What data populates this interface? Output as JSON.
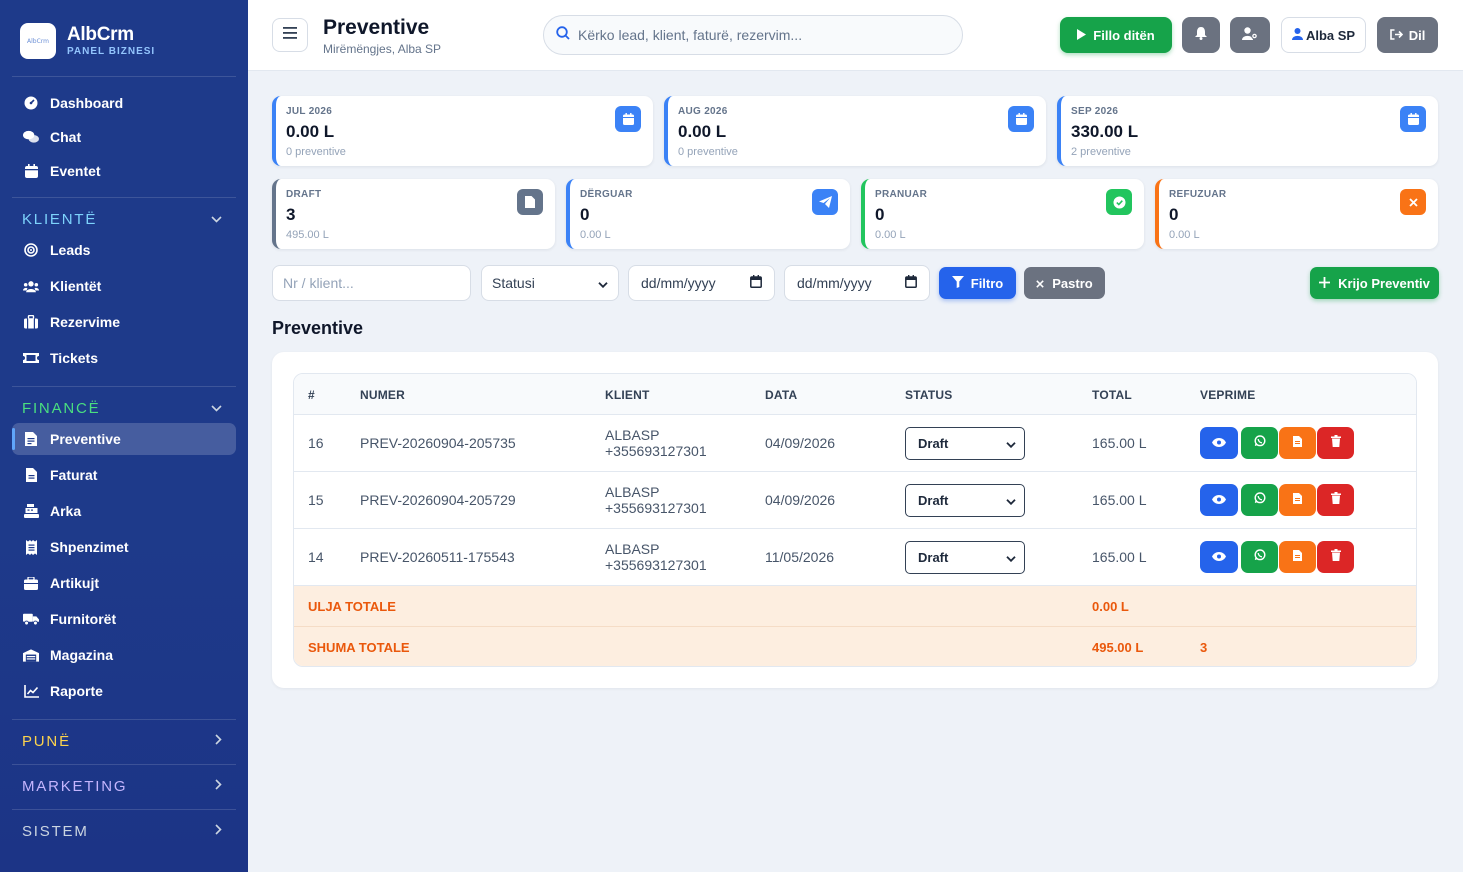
{
  "brand": {
    "name": "AlbCrm",
    "subtitle": "PANEL BIZNESI",
    "logo_text": "AlbCrm"
  },
  "sidebar": {
    "main": [
      {
        "label": "Dashboard",
        "icon": "gauge-icon"
      },
      {
        "label": "Chat",
        "icon": "chat-icon"
      },
      {
        "label": "Eventet",
        "icon": "calendar-icon"
      }
    ],
    "klientet": {
      "title": "KLIENTË",
      "color": "#7dd3fc",
      "items": [
        {
          "label": "Leads",
          "icon": "bullseye-icon"
        },
        {
          "label": "Klientët",
          "icon": "users-icon"
        },
        {
          "label": "Rezervime",
          "icon": "suitcase-icon"
        },
        {
          "label": "Tickets",
          "icon": "ticket-icon"
        }
      ]
    },
    "financa": {
      "title": "FINANCË",
      "color": "#4ade80",
      "items": [
        {
          "label": "Preventive",
          "icon": "file-invoice-icon",
          "active": true
        },
        {
          "label": "Faturat",
          "icon": "file-icon"
        },
        {
          "label": "Arka",
          "icon": "cash-register-icon"
        },
        {
          "label": "Shpenzimet",
          "icon": "receipt-icon"
        },
        {
          "label": "Artikujt",
          "icon": "box-icon"
        },
        {
          "label": "Furnitorët",
          "icon": "truck-icon"
        },
        {
          "label": "Magazina",
          "icon": "warehouse-icon"
        },
        {
          "label": "Raporte",
          "icon": "chart-line-icon"
        }
      ]
    },
    "collapsed": [
      {
        "title": "PUNË",
        "color": "#fcd34d"
      },
      {
        "title": "MARKETING",
        "color": "#c4b5fd"
      },
      {
        "title": "SISTEM",
        "color": "#cbd5e1"
      }
    ]
  },
  "header": {
    "title": "Preventive",
    "subtitle": "Mirëmëngjes, Alba SP",
    "search_placeholder": "Kërko lead, klient, faturë, rezervim...",
    "start_day_label": "Fillo ditën",
    "user_label": "Alba SP",
    "logout_label": "Dil"
  },
  "month_stats": [
    {
      "label": "JUL 2026",
      "value": "0.00 L",
      "sub": "0 preventive"
    },
    {
      "label": "AUG 2026",
      "value": "0.00 L",
      "sub": "0 preventive"
    },
    {
      "label": "SEP 2026",
      "value": "330.00 L",
      "sub": "2 preventive"
    }
  ],
  "status_stats": [
    {
      "label": "DRAFT",
      "value": "3",
      "sub": "495.00 L",
      "color": "#64748b",
      "icon": "file-icon"
    },
    {
      "label": "DËRGUAR",
      "value": "0",
      "sub": "0.00 L",
      "color": "#3b82f6",
      "icon": "paper-plane-icon"
    },
    {
      "label": "PRANUAR",
      "value": "0",
      "sub": "0.00 L",
      "color": "#22c55e",
      "icon": "check-circle-icon"
    },
    {
      "label": "REFUZUAR",
      "value": "0",
      "sub": "0.00 L",
      "color": "#f97316",
      "icon": "x-icon"
    }
  ],
  "filters": {
    "search_placeholder": "Nr / klient...",
    "status_label": "Statusi",
    "date_from": "dd/mm/yyyy",
    "date_to": "dd/mm/yyyy",
    "filter_label": "Filtro",
    "clear_label": "Pastro",
    "create_label": "Krijo Preventiv"
  },
  "section_title": "Preventive",
  "table": {
    "headers": [
      "#",
      "NUMER",
      "KLIENT",
      "DATA",
      "STATUS",
      "TOTAL",
      "VEPRIME"
    ],
    "rows": [
      {
        "id": "16",
        "number": "PREV-20260904-205735",
        "client_name": "ALBASP",
        "client_phone": "+355693127301",
        "date": "04/09/2026",
        "status": "Draft",
        "total": "165.00 L"
      },
      {
        "id": "15",
        "number": "PREV-20260904-205729",
        "client_name": "ALBASP",
        "client_phone": "+355693127301",
        "date": "04/09/2026",
        "status": "Draft",
        "total": "165.00 L"
      },
      {
        "id": "14",
        "number": "PREV-20260511-175543",
        "client_name": "ALBASP",
        "client_phone": "+355693127301",
        "date": "11/05/2026",
        "status": "Draft",
        "total": "165.00 L"
      }
    ],
    "discount_label": "ULJA TOTALE",
    "discount_value": "0.00 L",
    "sum_label": "SHUMA TOTALE",
    "sum_value": "495.00 L",
    "sum_count": "3"
  }
}
